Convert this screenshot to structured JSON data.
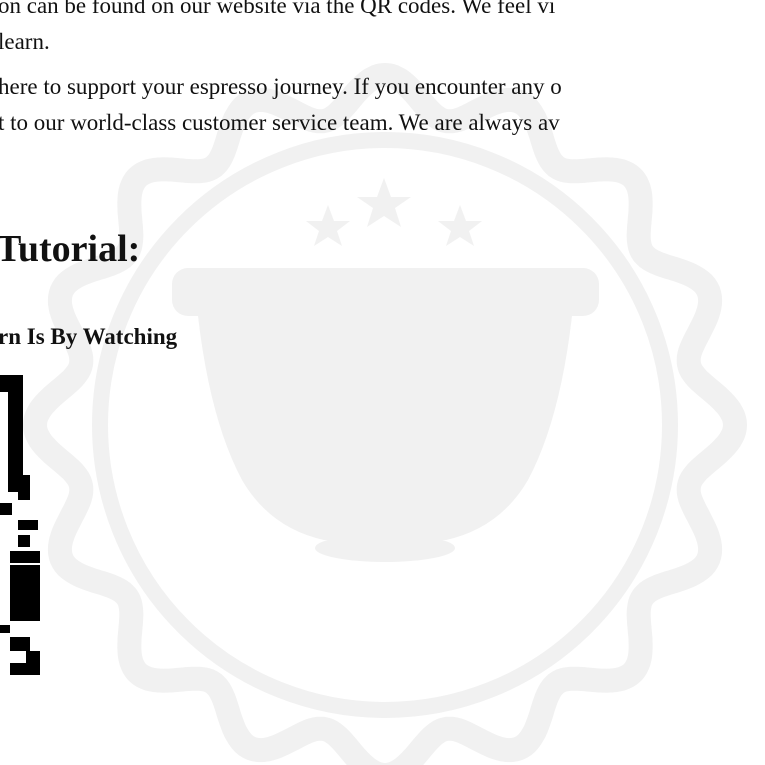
{
  "body": {
    "lines": [
      "on can be found on our website via the QR codes. We feel vi",
      "learn.",
      "here to support your espresso journey. If you encounter any o",
      "t to our world-class customer service team. We are always av"
    ]
  },
  "section": {
    "title": "Tutorial:",
    "subtitle": "rn Is By Watching"
  },
  "colors": {
    "text": "#111111",
    "watermark": "#f1f1f1",
    "background": "#ffffff"
  },
  "icons": {
    "watermark": "coffee-capsule-badge-icon",
    "qr": "qr-code-icon"
  }
}
